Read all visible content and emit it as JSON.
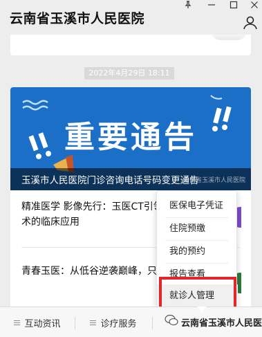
{
  "window": {
    "title": "云南省玉溪市人民医院"
  },
  "feed": {
    "timestamp": "2022年4月29日  18:11",
    "article": {
      "banner_text": "重要通告",
      "banner_watermark": "云南省玉溪市人民医院",
      "headline": "玉溪市人民医院门诊咨询电话号码变更通告"
    },
    "items": [
      {
        "title": "精准医学 影像先行：玉医CT引领检术的临床应用"
      },
      {
        "title": "青春玉医：从低谷逆袭巅峰，只"
      }
    ]
  },
  "popup_menu": {
    "items": [
      {
        "label": "医保电子凭证"
      },
      {
        "label": "住院预缴"
      },
      {
        "label": "我的预约"
      },
      {
        "label": "报告查看"
      },
      {
        "label": "就诊人管理"
      }
    ],
    "highlighted_index": 4,
    "highlight_color": "#e4262a"
  },
  "bottom_nav": {
    "items": [
      {
        "label": "互动资讯"
      },
      {
        "label": "诊疗服务"
      }
    ],
    "watermark": "云南省玉溪市人民医院"
  },
  "colors": {
    "banner_bg": "#1c6fc6",
    "background": "#ededed",
    "highlight": "#e4262a"
  }
}
